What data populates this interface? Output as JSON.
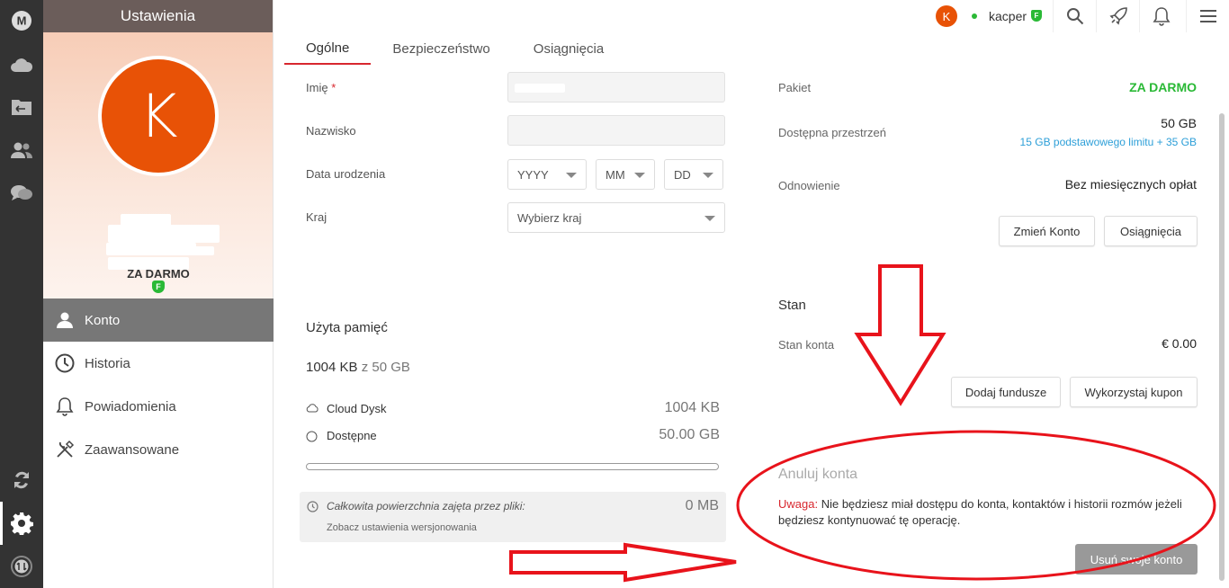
{
  "app": {
    "logo_letter": "M",
    "colors": {
      "accent_red": "#d8272e",
      "brand_orange": "#e85206",
      "free_green": "#2ab936",
      "link_blue": "#2d9fd8",
      "rail_bg": "#333333"
    }
  },
  "rail": {
    "icons": [
      "mega-logo-icon",
      "cloud-drive-icon",
      "shared-folder-icon",
      "contacts-icon",
      "chat-icon",
      "transfers-icon",
      "settings-gear-icon",
      "sync-status-icon"
    ]
  },
  "settings_panel": {
    "title": "Ustawienia",
    "avatar_letter": "K",
    "plan_badge": "F",
    "plan_label": "ZA DARMO",
    "menu": [
      {
        "label": "Konto",
        "icon": "user-icon",
        "active": true
      },
      {
        "label": "Historia",
        "icon": "clock-icon",
        "active": false
      },
      {
        "label": "Powiadomienia",
        "icon": "bell-icon",
        "active": false
      },
      {
        "label": "Zaawansowane",
        "icon": "tools-icon",
        "active": false
      }
    ]
  },
  "topbar": {
    "avatar_letter": "K",
    "username": "kacper",
    "badge": "F"
  },
  "tabs": [
    {
      "label": "Ogólne",
      "active": true
    },
    {
      "label": "Bezpieczeństwo",
      "active": false
    },
    {
      "label": "Osiągnięcia",
      "active": false
    }
  ],
  "form": {
    "first_name_label": "Imię",
    "required_mark": "*",
    "last_name_label": "Nazwisko",
    "birthdate_label": "Data urodzenia",
    "year": "YYYY",
    "month": "MM",
    "day": "DD",
    "country_label": "Kraj",
    "country_value": "Wybierz kraj"
  },
  "storage": {
    "title": "Użyta pamięć",
    "used": "1004 KB",
    "of_word": "z",
    "total": "50 GB",
    "used_fraction": 2e-05,
    "rows": [
      {
        "label": "Cloud Dysk",
        "value": "1004 KB"
      },
      {
        "label": "Dostępne",
        "value": "50.00 GB"
      }
    ],
    "total_files_label": "Całkowita powierzchnia zajęta przez pliki:",
    "total_files_value": "0 MB",
    "versioning_link": "Zobacz ustawienia wersjonowania"
  },
  "account": {
    "package_label": "Pakiet",
    "package_value": "ZA DARMO",
    "space_label": "Dostępna przestrzeń",
    "space_value": "50 GB",
    "space_detail": "15 GB podstawowego limitu + 35 GB",
    "renewal_label": "Odnowienie",
    "renewal_value": "Bez miesięcznych opłat",
    "change_button": "Zmień Konto",
    "achievements_button": "Osiągnięcia",
    "status_title": "Stan",
    "balance_label": "Stan konta",
    "balance_value": "€ 0.00",
    "add_funds_button": "Dodaj fundusze",
    "redeem_button": "Wykorzystaj kupon",
    "cancel_title": "Anuluj konta",
    "warning_prefix": "Uwaga:",
    "warning_text": "Nie będziesz miał dostępu do konta, kontaktów i historii rozmów jeżeli będziesz kontynuować tę operację.",
    "delete_button": "Usuń swoje konto"
  }
}
